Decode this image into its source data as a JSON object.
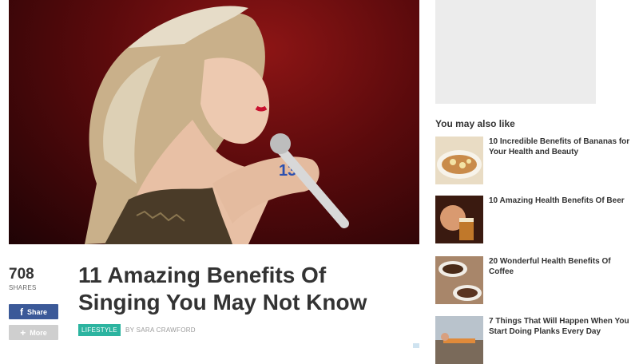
{
  "article": {
    "title": "11 Amazing Benefits Of Singing You May Not Know",
    "category": "LIFESTYLE",
    "byline": "BY SARA CRAWFORD"
  },
  "share": {
    "count": "708",
    "count_label": "SHARES",
    "share_button": "Share",
    "more_button": "More",
    "share_icon": "facebook-f-icon",
    "more_icon": "plus-icon"
  },
  "sidebar": {
    "heading": "You may also like",
    "related": [
      {
        "title": "10 Incredible Benefits of Bananas for Your Health and Beauty"
      },
      {
        "title": "10 Amazing Health Benefits Of Beer"
      },
      {
        "title": "20 Wonderful Health Benefits Of Coffee"
      },
      {
        "title": "7 Things That Will Happen When You Start Doing Planks Every Day"
      }
    ]
  },
  "colors": {
    "facebook": "#3b5998",
    "category_badge": "#2cb4a0",
    "text": "#333333"
  }
}
